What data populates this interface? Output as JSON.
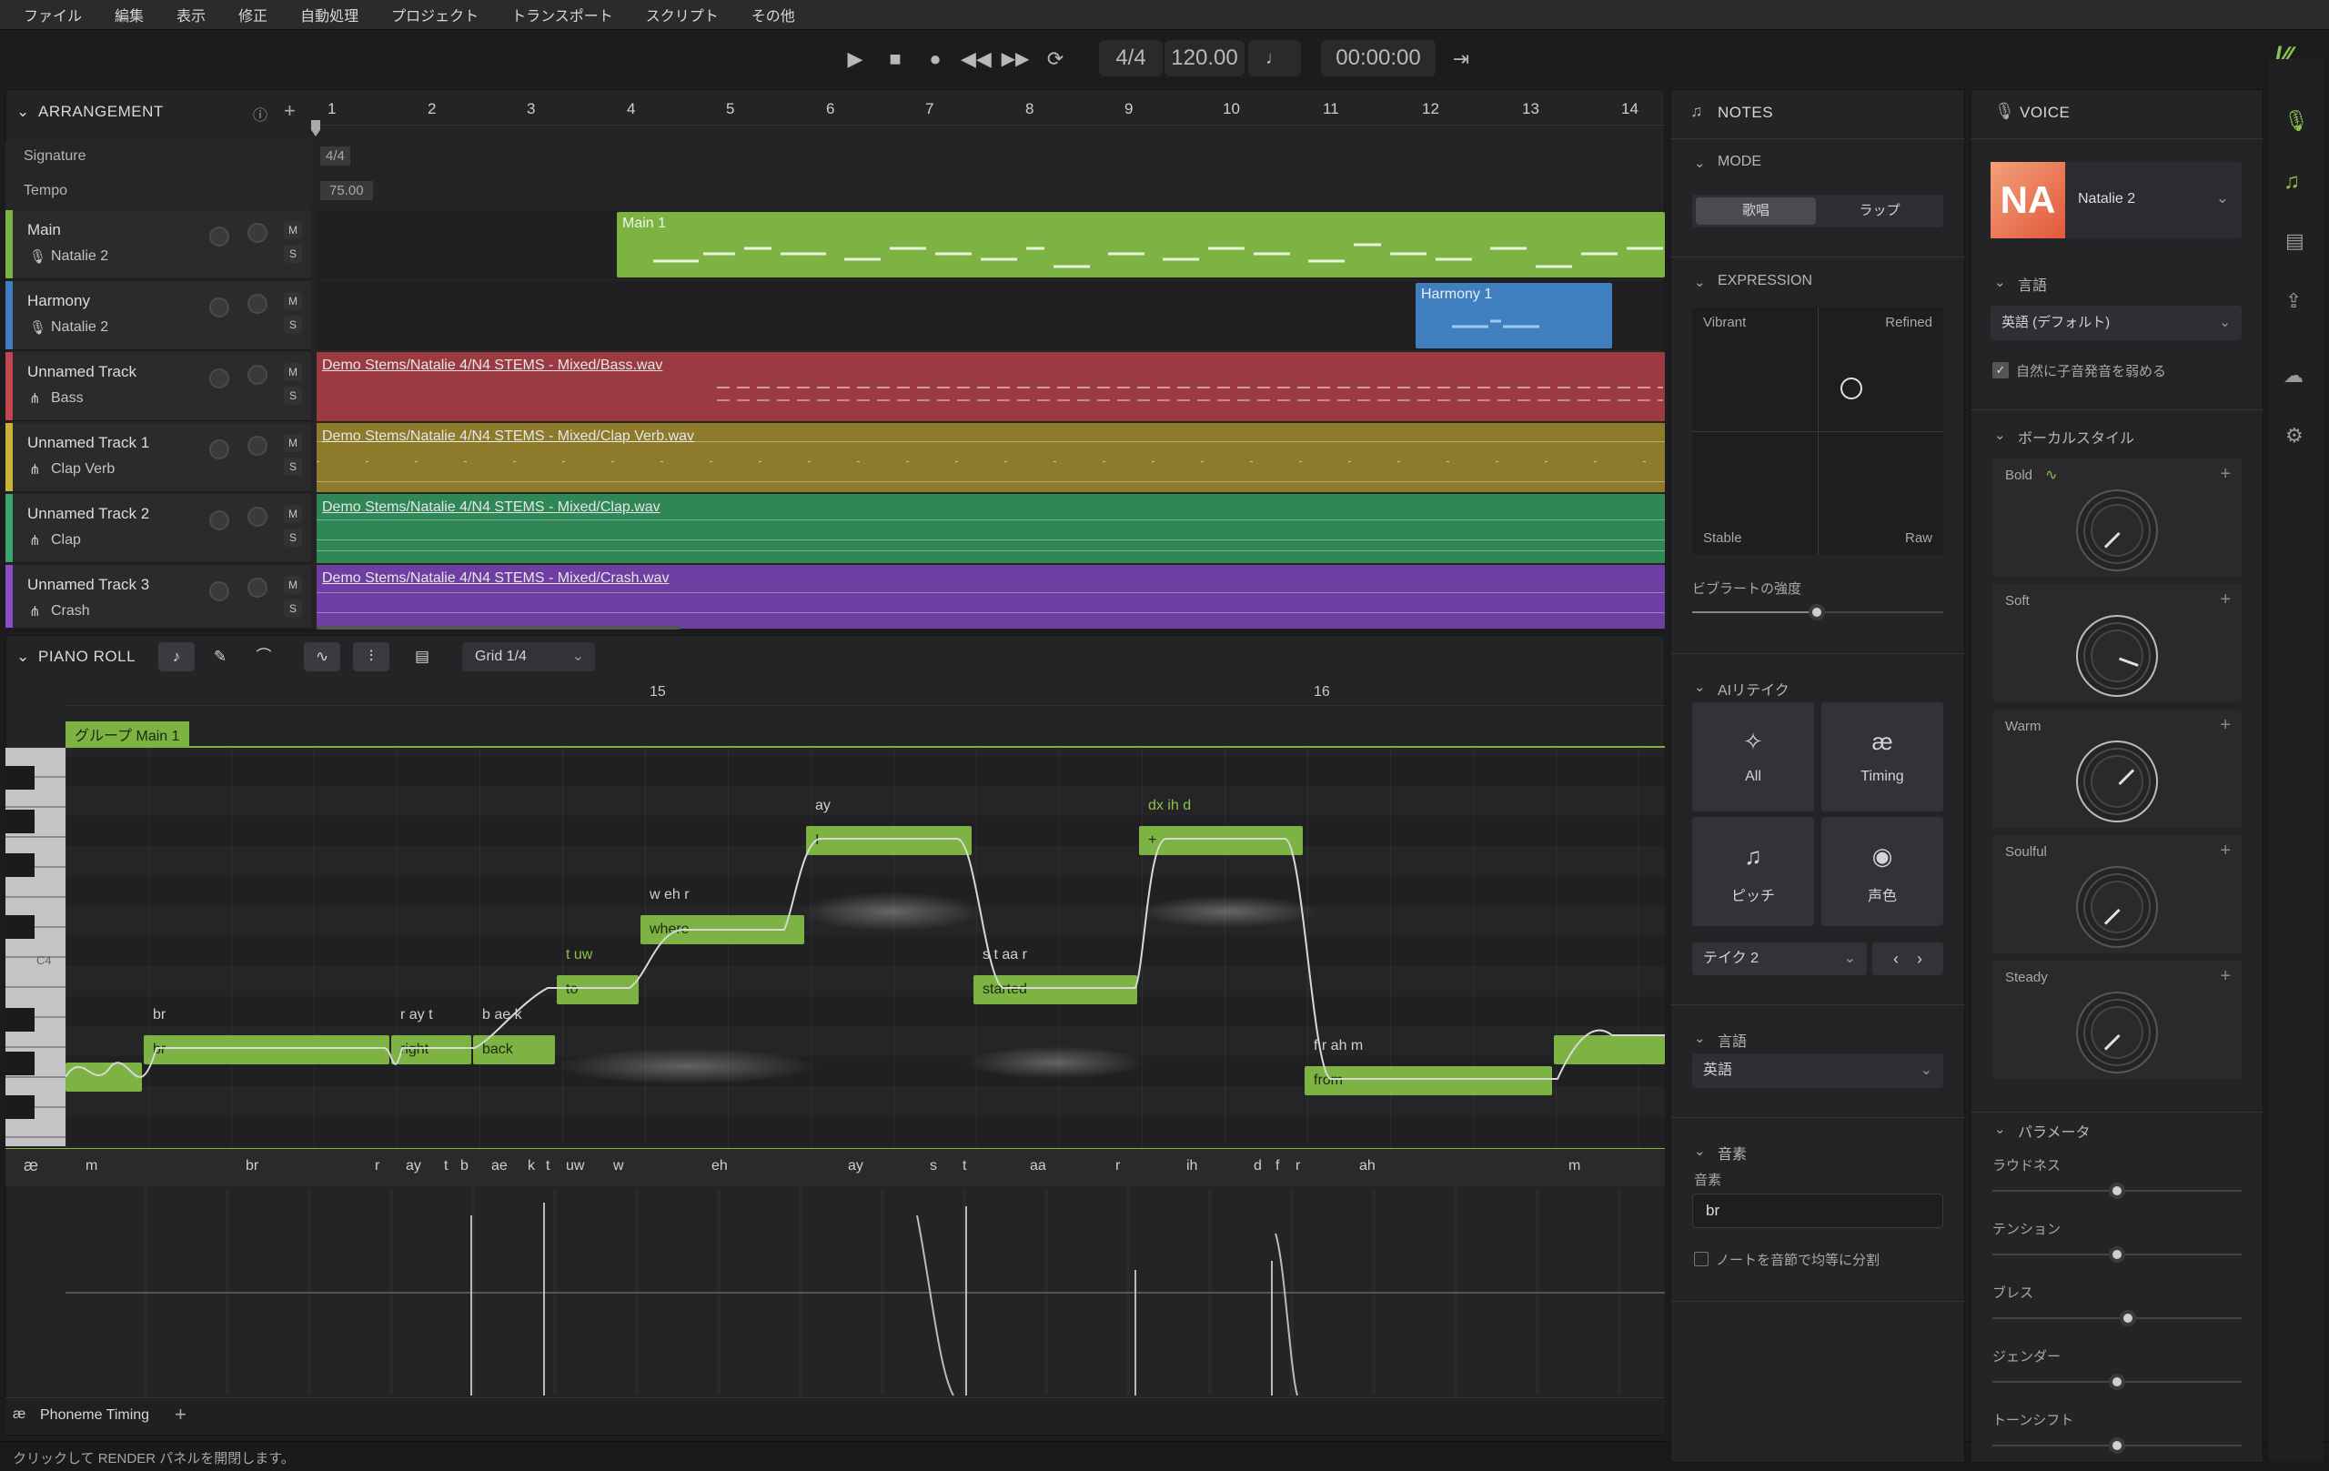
{
  "menu": [
    "ファイル",
    "編集",
    "表示",
    "修正",
    "自動処理",
    "プロジェクト",
    "トランスポート",
    "スクリプト",
    "その他"
  ],
  "transport": {
    "signature": "4/4",
    "tempo": "120.00",
    "time": "00:00:00"
  },
  "arrangement": {
    "title": "ARRANGEMENT",
    "ruler": [
      "1",
      "2",
      "3",
      "4",
      "5",
      "6",
      "7",
      "8",
      "9",
      "10",
      "11",
      "12",
      "13",
      "14"
    ],
    "signature_label": "Signature",
    "signature_value": "4/4",
    "tempo_label": "Tempo",
    "tempo_value": "75.00",
    "tracks": [
      {
        "name": "Main",
        "sub": "Natalie 2",
        "color": "#7cb342"
      },
      {
        "name": "Harmony",
        "sub": "Natalie 2",
        "color": "#3f7fbf"
      },
      {
        "name": "Unnamed Track",
        "sub": "Bass",
        "color": "#c0474f"
      },
      {
        "name": "Unnamed Track 1",
        "sub": "Clap Verb",
        "color": "#c9b23a"
      },
      {
        "name": "Unnamed Track 2",
        "sub": "Clap",
        "color": "#3aa66b"
      },
      {
        "name": "Unnamed Track 3",
        "sub": "Crash",
        "color": "#8a4fc7"
      }
    ],
    "clips": {
      "main": "Main 1",
      "harmony": "Harmony 1",
      "bass": "Demo Stems/Natalie 4/N4 STEMS - Mixed/Bass.wav",
      "clapverb": "Demo Stems/Natalie 4/N4 STEMS - Mixed/Clap Verb.wav",
      "clap": "Demo Stems/Natalie 4/N4 STEMS - Mixed/Clap.wav",
      "crash": "Demo Stems/Natalie 4/N4 STEMS - Mixed/Crash.wav"
    },
    "ms_m": "M",
    "ms_s": "S"
  },
  "pianoroll": {
    "title": "PIANO ROLL",
    "grid": "Grid 1/4",
    "bar15": "15",
    "bar16": "16",
    "group": "グループ Main 1",
    "c4": "C4",
    "notes": [
      {
        "lyric": "br",
        "phon": "br"
      },
      {
        "lyric": "right",
        "phon": "r ay t"
      },
      {
        "lyric": "back",
        "phon": "b ae k"
      },
      {
        "lyric": "to",
        "phon": "t uw"
      },
      {
        "lyric": "where",
        "phon": "w eh r"
      },
      {
        "lyric": "I",
        "phon": "ay"
      },
      {
        "lyric": "started",
        "phon": "s t aa r"
      },
      {
        "lyric": "+",
        "phon": "dx ih d"
      },
      {
        "lyric": "from",
        "phon": "f r ah m"
      }
    ],
    "phonemes": [
      "m",
      "br",
      "r",
      "ay",
      "t",
      "b",
      "ae",
      "k",
      "t",
      "uw",
      "w",
      "eh",
      "ay",
      "s",
      "t",
      "aa",
      "r",
      "ih",
      "d",
      "f",
      "r",
      "ah",
      "m"
    ],
    "bottom_tab": "Phoneme Timing"
  },
  "status": "クリックして RENDER パネルを開閉します。",
  "notes_panel": {
    "title": "NOTES",
    "mode": "MODE",
    "mode_opts": [
      "歌唱",
      "ラップ"
    ],
    "expression": "EXPRESSION",
    "vibrant": "Vibrant",
    "refined": "Refined",
    "stable": "Stable",
    "raw": "Raw",
    "vibrato": "ビブラートの強度",
    "retake": "AIリテイク",
    "retake_btns": [
      "All",
      "Timing",
      "ピッチ",
      "声色"
    ],
    "take": "テイク 2",
    "language": "言語",
    "language_val": "英語",
    "phoneme": "音素",
    "phoneme_label": "音素",
    "phoneme_val": "br",
    "split": "ノートを音節で均等に分割"
  },
  "voice_panel": {
    "title": "VOICE",
    "voice_name": "Natalie 2",
    "logo": "NA",
    "language": "言語",
    "language_val": "英語 (デフォルト)",
    "soften": "自然に子音発音を弱める",
    "style": "ボーカルスタイル",
    "styles": [
      "Bold",
      "Soft",
      "Warm",
      "Soulful",
      "Steady"
    ],
    "params": "パラメータ",
    "param_list": [
      "ラウドネス",
      "テンション",
      "ブレス",
      "ジェンダー",
      "トーンシフト"
    ]
  }
}
